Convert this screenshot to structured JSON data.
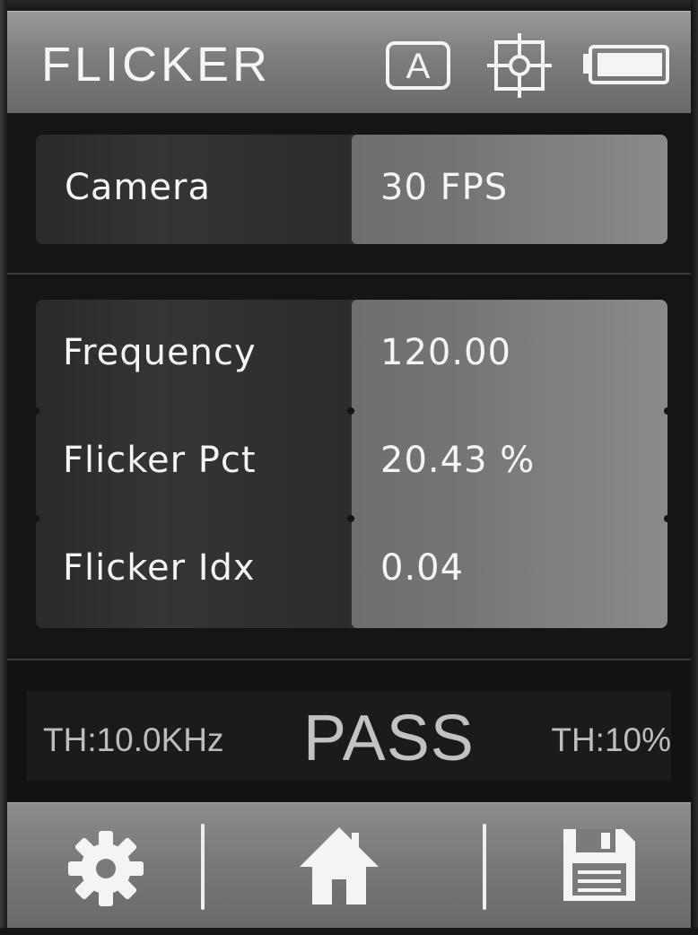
{
  "header": {
    "title": "FLICKER",
    "mode_badge": "A",
    "icons": [
      "auto-mode-icon",
      "crosshair-target-icon",
      "battery-icon"
    ],
    "battery_level": 1.0
  },
  "camera": {
    "label": "Camera",
    "value": "30 FPS"
  },
  "measurements": [
    {
      "label": "Frequency",
      "value": "120.00"
    },
    {
      "label": "Flicker Pct",
      "value": "20.43 %"
    },
    {
      "label": "Flicker Idx",
      "value": "0.04"
    }
  ],
  "status": {
    "threshold_left": "TH:10.0KHz",
    "result": "PASS",
    "threshold_right": "TH:10%"
  },
  "nav": {
    "icons": [
      "gear-icon",
      "home-icon",
      "floppy-disk-icon"
    ]
  },
  "colors": {
    "header_bg": "#7d7d7d",
    "value_panel_bg": "#7e7e7e",
    "label_panel_bg": "#303030",
    "status_text": "#c2c2c2",
    "icon_fg": "#f4f4f4"
  }
}
